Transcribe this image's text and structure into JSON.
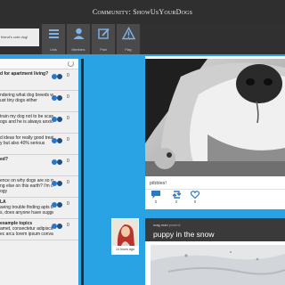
{
  "app": {
    "title": "Community: ShowUsYourDogs"
  },
  "search": {
    "value": "friend's cute dog!"
  },
  "nav": [
    {
      "label": "Lists"
    },
    {
      "label": "Members"
    },
    {
      "label": "Post"
    },
    {
      "label": "Flag"
    }
  ],
  "threads": [
    {
      "text": "d for apartment living?",
      "bold": true,
      "count": "0"
    },
    {
      "text": "ndering what dog breeds would",
      "bold": false,
      "count": "0"
    },
    {
      "text": "ust tiny dogs either",
      "bold": false,
      "count": ""
    },
    {
      "text": "train my dog not to be scared of",
      "bold": false,
      "count": "0"
    },
    {
      "text": "ogs and he is always anxiols",
      "bold": false,
      "count": ""
    },
    {
      "text": "d ideas for really good treat Done",
      "bold": false,
      "count": "0"
    },
    {
      "text": "y but also 40% serious",
      "bold": false,
      "count": ""
    },
    {
      "text": "ed?",
      "bold": true,
      "count": "0"
    },
    {
      "text": "ence on why dogs are so much",
      "bold": false,
      "count": "0"
    },
    {
      "text": "ng else on this earth? I'm curious",
      "bold": false,
      "count": ""
    },
    {
      "text": "ogy",
      "bold": false,
      "count": ""
    },
    {
      "text": "LA",
      "bold": true,
      "count": "0"
    },
    {
      "text": "aving trouble finding apts that",
      "bold": false,
      "count": ""
    },
    {
      "text": "s, does anyone have suggestions?",
      "bold": false,
      "count": ""
    },
    {
      "text": "example topics",
      "bold": true,
      "count": "0"
    },
    {
      "text": "amet, consectetur adipiscing",
      "bold": false,
      "count": ""
    },
    {
      "text": "ec arcu lorem ipsum convallis",
      "bold": false,
      "count": ""
    }
  ],
  "post1": {
    "caption": "pibbles!",
    "reply_count": "0",
    "repost_count": "0",
    "like_count": "0"
  },
  "post2": {
    "author": "mag man",
    "verb": "posted:",
    "title": "puppy in the snow",
    "time": "14 hours ago"
  },
  "colors": {
    "accent": "#29a3e3",
    "nav": "#303030",
    "icon": "#2a78c8"
  }
}
